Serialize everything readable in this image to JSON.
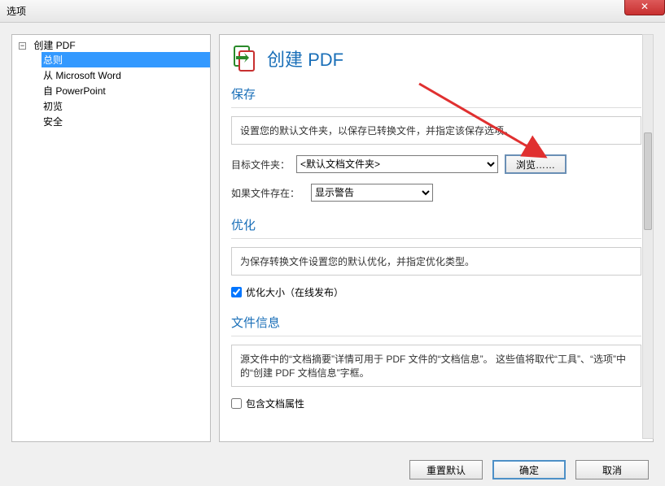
{
  "titlebar": {
    "title": "选项"
  },
  "sidebar": {
    "root_label": "创建 PDF",
    "items": [
      {
        "label": "总则",
        "selected": true
      },
      {
        "label": "从 Microsoft Word",
        "selected": false
      },
      {
        "label": "自 PowerPoint",
        "selected": false
      },
      {
        "label": "初览",
        "selected": false
      },
      {
        "label": "安全",
        "selected": false
      }
    ]
  },
  "page": {
    "title": "创建 PDF",
    "save_section": {
      "heading": "保存",
      "description": "设置您的默认文件夹，以保存已转换文件，并指定该保存选项。",
      "target_folder_label": "目标文件夹：",
      "target_folder_value": "<默认文档文件夹>",
      "browse_label": "浏览……",
      "if_exists_label": "如果文件存在：",
      "if_exists_value": "显示警告"
    },
    "optimize_section": {
      "heading": "优化",
      "description": "为保存转换文件设置您的默认优化，并指定优化类型。",
      "checkbox_label": "优化大小（在线发布）",
      "checkbox_checked": true
    },
    "fileinfo_section": {
      "heading": "文件信息",
      "description": "源文件中的“文档摘要”详情可用于 PDF 文件的“文档信息”。 这些值将取代“工具”、“选项”中的“创建 PDF 文档信息”字框。",
      "checkbox_label": "包含文档属性",
      "checkbox_checked": false
    }
  },
  "footer": {
    "reset_label": "重置默认",
    "ok_label": "确定",
    "cancel_label": "取消"
  }
}
